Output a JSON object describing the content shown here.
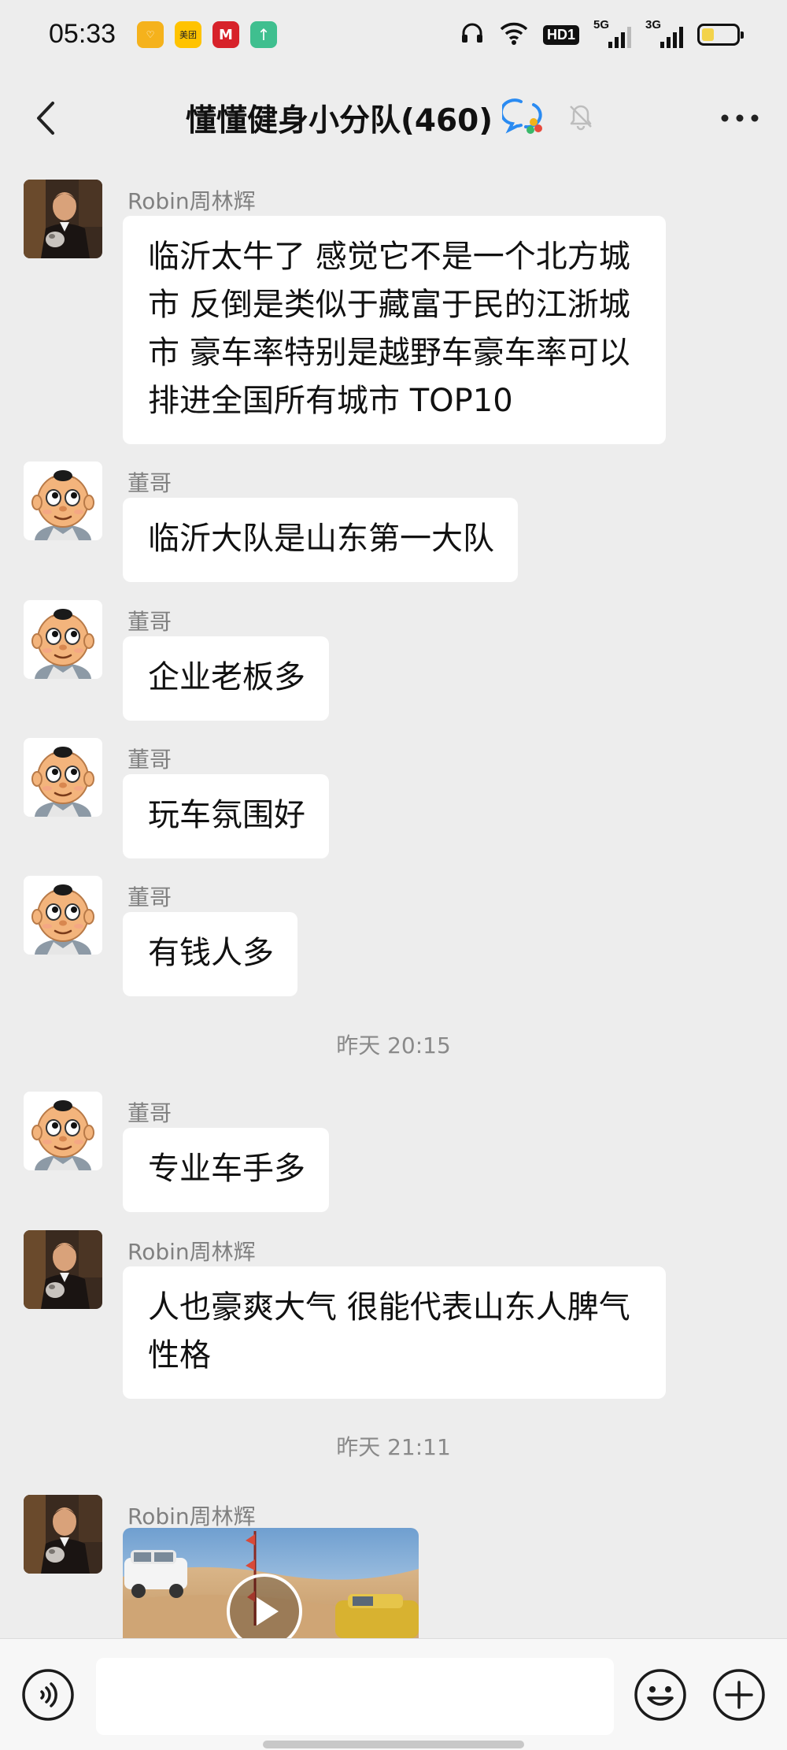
{
  "status_bar": {
    "time": "05:33",
    "app_icons": [
      {
        "name": "heart-app-icon",
        "color": "#f5b21c",
        "glyph": "♡"
      },
      {
        "name": "meituan-app-icon",
        "color": "#ffc300",
        "glyph": "美团"
      },
      {
        "name": "merchants-bank-app-icon",
        "color": "#d7222a",
        "glyph": "M"
      },
      {
        "name": "upload-app-icon",
        "color": "#3fbf8f",
        "glyph": "↑"
      }
    ],
    "hd_label": "HD1",
    "signal_1_label": "5G",
    "signal_2_label": "3G",
    "battery_level": 0.35
  },
  "nav": {
    "title": "懂懂健身小分队(460)"
  },
  "messages": [
    {
      "sender": "Robin周林辉",
      "avatar": "robin",
      "lines": [
        "临沂太牛了 感觉它不是一个北方城",
        "市 反倒是类似于藏富于民的江浙城",
        "市 豪车率特别是越野车豪车率可以",
        "排进全国所有城市 TOP10"
      ]
    },
    {
      "sender": "董哥",
      "avatar": "dongge",
      "lines": [
        "临沂大队是山东第一大队"
      ]
    },
    {
      "sender": "董哥",
      "avatar": "dongge",
      "lines": [
        "企业老板多"
      ]
    },
    {
      "sender": "董哥",
      "avatar": "dongge",
      "lines": [
        "玩车氛围好"
      ]
    },
    {
      "sender": "董哥",
      "avatar": "dongge",
      "lines": [
        "有钱人多"
      ]
    },
    {
      "sender": "董哥",
      "avatar": "dongge",
      "lines": [
        "专业车手多"
      ]
    },
    {
      "sender": "Robin周林辉",
      "avatar": "robin",
      "lines": [
        "人也豪爽大气 很能代表山东人脾气",
        "性格"
      ]
    },
    {
      "sender": "Robin周林辉",
      "avatar": "robin",
      "type": "video"
    }
  ],
  "timestamps": [
    "昨天 20:15",
    "昨天 21:11"
  ],
  "input": {
    "placeholder": ""
  },
  "colors": {
    "background": "#ededed",
    "bubble": "#ffffff",
    "sender_text": "#808080",
    "accent_blue": "#2a8bf2"
  }
}
